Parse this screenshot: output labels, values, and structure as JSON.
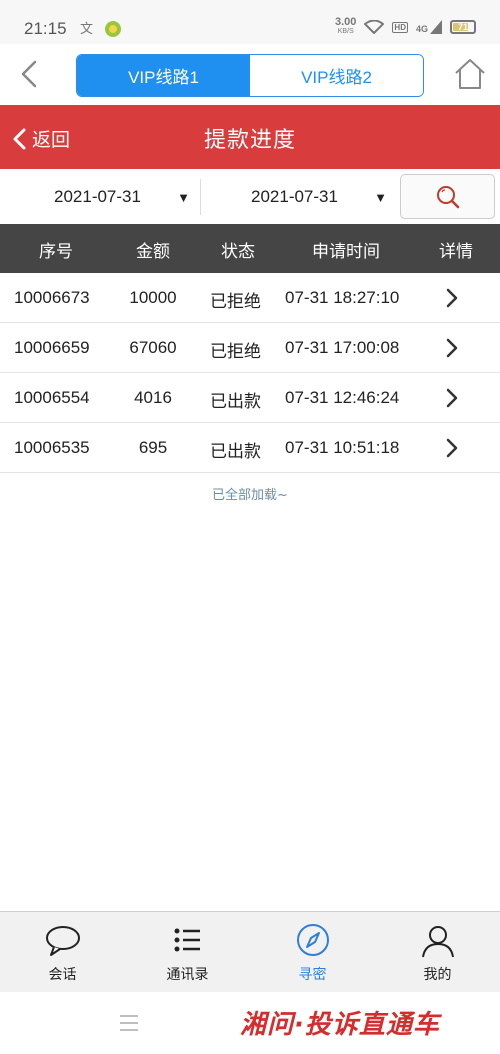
{
  "status_bar": {
    "time": "21:15",
    "speed": "3.00",
    "speed_unit": "KB/S",
    "hd": "HD",
    "net": "4G",
    "battery": "71"
  },
  "nav": {
    "tabs": [
      "VIP线路1",
      "VIP线路2"
    ],
    "active_tab": 0
  },
  "header": {
    "back_label": "返回",
    "title": "提款进度"
  },
  "filter": {
    "start_date": "2021-07-31",
    "end_date": "2021-07-31",
    "caret": "▼"
  },
  "table": {
    "columns": [
      "序号",
      "金额",
      "状态",
      "申请时间",
      "详情"
    ],
    "rows": [
      {
        "id": "10006673",
        "amount": "10000",
        "status": "已拒绝",
        "time": "07-31 18:27:10"
      },
      {
        "id": "10006659",
        "amount": "67060",
        "status": "已拒绝",
        "time": "07-31 17:00:08"
      },
      {
        "id": "10006554",
        "amount": "4016",
        "status": "已出款",
        "time": "07-31 12:46:24"
      },
      {
        "id": "10006535",
        "amount": "695",
        "status": "已出款",
        "time": "07-31 10:51:18"
      }
    ],
    "footer_note": "已全部加载~"
  },
  "bottom_nav": {
    "items": [
      {
        "label": "会话",
        "icon": "chat-bubble-icon"
      },
      {
        "label": "通讯录",
        "icon": "list-icon"
      },
      {
        "label": "寻密",
        "icon": "compass-icon"
      },
      {
        "label": "我的",
        "icon": "person-icon"
      }
    ],
    "active_index": 2
  },
  "watermark": "湘问·投诉直通车",
  "colors": {
    "accent_blue": "#1f8ff0",
    "header_red": "#d93c3c",
    "table_header": "#454545"
  }
}
